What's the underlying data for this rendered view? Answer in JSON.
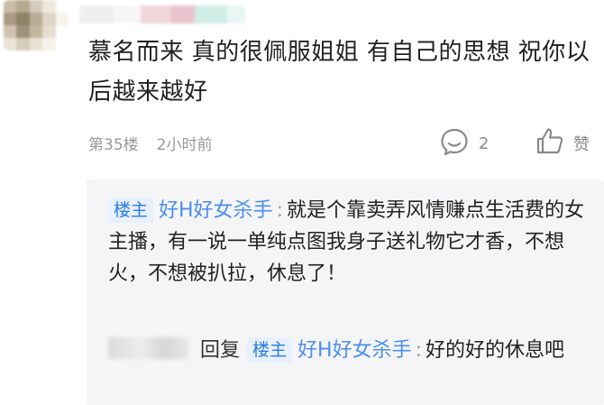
{
  "post": {
    "avatar_colors": [
      "#c9bda9",
      "#b6a98f",
      "#d5cbbb",
      "#efe8dc",
      "#ffffff",
      "#a89a80",
      "#8f8167",
      "#b9ad97",
      "#dfd6c7",
      "#f7f2ea",
      "#cfc3b0",
      "#9e907a",
      "#c3b69f",
      "#e6ddce",
      "#ffffff",
      "#ece4d7",
      "#d8ccb9",
      "#e9e1d3",
      "#f6f1e8",
      "#ffffff"
    ],
    "username_blur_colors": [
      "#efefef",
      "#f6f6f6",
      "#f1d6dc",
      "#e9c3cd",
      "#cfeee6",
      "#e9f7f4"
    ],
    "comment_text": "慕名而来  真的很佩服姐姐  有自己的思想  祝你以后越来越好",
    "floor": "第35楼",
    "time_ago": "2小时前",
    "reply_count": "2",
    "like_label": "赞"
  },
  "replies": [
    {
      "badge": "楼主",
      "author": "好H好女杀手",
      "text": "就是个靠卖弄风情赚点生活费的女主播，有一说一单纯点图我身子送礼物它才香，不想火，不想被扒拉，休息了！"
    },
    {
      "reply_word": "回复",
      "target_badge": "楼主",
      "target_author": "好H好女杀手",
      "text": "好的好的休息吧"
    }
  ]
}
